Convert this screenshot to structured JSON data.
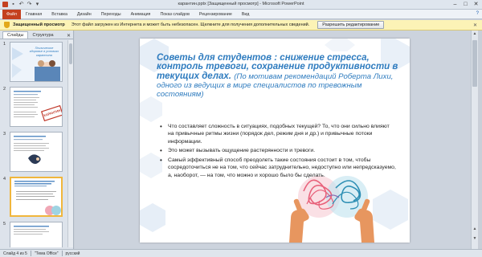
{
  "window": {
    "title": "карантин.pptx [Защищенный просмотр] - Microsoft PowerPoint"
  },
  "ribbon": {
    "tabs": [
      "Файл",
      "Главная",
      "Вставка",
      "Дизайн",
      "Переходы",
      "Анимация",
      "Показ слайдов",
      "Рецензирование",
      "Вид"
    ]
  },
  "message_bar": {
    "title": "Защищенный просмотр",
    "text": "Этот файл загружен из Интернета и может быть небезопасен. Щелкните для получения дополнительных сведений.",
    "button": "Разрешить редактирование"
  },
  "left_pane": {
    "tabs": [
      "Слайды",
      "Структура"
    ],
    "slide_numbers": [
      "1",
      "2",
      "3",
      "4",
      "5"
    ],
    "slide1_text": "Психическое здоровье в условиях карантина",
    "slide2_stamp": "КАРАНТИН"
  },
  "slide": {
    "title_bold": "Советы для студентов : снижение стресса, контроль тревоги, сохранение продуктивности в текущих делах.",
    "title_sub": "(По мотивам рекомендаций Роберта Лихи, одного из ведущих в мире специалистов по тревожным состояниям)",
    "bullets": [
      "Что составляет сложность в ситуациях, подобных текущей? То, что они сильно влияют на привычные ритмы жизни (порядок дел, режим дня и др.) и привычные потоки информации.",
      "Это может вызывать ощущение растерянности и тревоги.",
      "Самый эффективный способ преодолеть такие состояния состоит в том, чтобы сосредоточиться не на том, что сейчас затруднительно, недоступно или непредсказуемо, а, наоборот, — на том, что можно и хорошо было бы сделать."
    ]
  },
  "status_bar": {
    "slide": "Слайд 4 из 5",
    "theme": "\"Тема Office\"",
    "language": "русский"
  },
  "colors": {
    "accent_title": "#2f7cbf",
    "file_tab": "#c4401f",
    "message_bar": "#fcf3b6"
  }
}
